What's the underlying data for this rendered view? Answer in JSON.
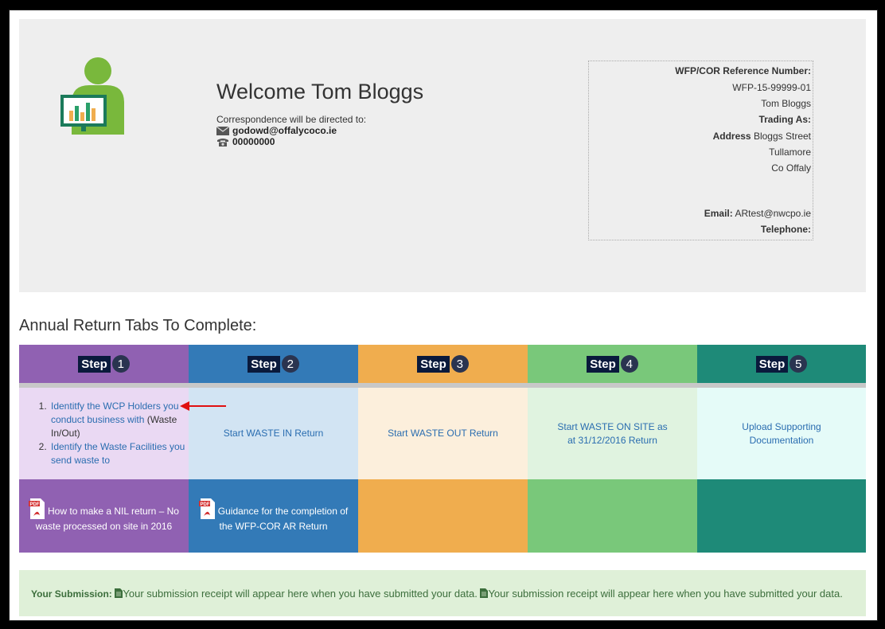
{
  "header": {
    "welcome": "Welcome Tom Bloggs",
    "correspondence_label": "Correspondence will be directed to:",
    "email": "godowd@offalycoco.ie",
    "phone": "00000000"
  },
  "reference": {
    "ref_label": "WFP/COR Reference Number:",
    "ref_number": "WFP-15-99999-01",
    "name": "Tom Bloggs",
    "trading_label": "Trading As:",
    "address_label": "Address",
    "address_line1": "Bloggs Street",
    "address_line2": "Tullamore",
    "address_line3": "Co Offaly",
    "email_label": "Email:",
    "email": "ARtest@nwcpo.ie",
    "telephone_label": "Telephone:"
  },
  "tabs_title": "Annual Return Tabs To Complete:",
  "steps": [
    {
      "word": "Step",
      "num": "1",
      "color": "#9061b2",
      "body_color": "#ead9f3",
      "foot_color": "#9061b2",
      "items": [
        {
          "link": "Identitfy the WCP Holders you conduct business with",
          "suffix": "(Waste In/Out)"
        },
        {
          "link": "Identify the Waste Facilities you send waste to"
        }
      ],
      "foot_text": "How to make a NIL return – No waste processed on site in 2016"
    },
    {
      "word": "Step",
      "num": "2",
      "color": "#337ab7",
      "body_color": "#d2e4f3",
      "foot_color": "#337ab7",
      "body_text": "Start WASTE IN Return",
      "foot_text": "Guidance for the completion of the WFP-COR AR Return"
    },
    {
      "word": "Step",
      "num": "3",
      "color": "#f0ad4e",
      "body_color": "#fcefdc",
      "foot_color": "#f0ad4e",
      "body_text": "Start WASTE OUT Return",
      "foot_text": ""
    },
    {
      "word": "Step",
      "num": "4",
      "color": "#79c87a",
      "body_color": "#e0f3e0",
      "foot_color": "#79c87a",
      "body_text": "Start WASTE ON SITE as at 31/12/2016 Return",
      "foot_text": ""
    },
    {
      "word": "Step",
      "num": "5",
      "color": "#1e8a78",
      "body_color": "#e5fbf8",
      "foot_color": "#1e8a78",
      "body_text": "Upload Supporting Documentation",
      "foot_text": ""
    }
  ],
  "submission": {
    "label": "Your Submission:",
    "text1": "Your submission receipt will appear here when you have submitted your data.",
    "text2": "Your submission receipt will appear here when you have submitted your data."
  },
  "icons": {
    "avatar": "user-chart-icon",
    "email": "envelope-icon",
    "phone": "telephone-icon",
    "pdf": "pdf-icon",
    "doc": "document-icon",
    "arrow": "red-arrow-icon"
  }
}
